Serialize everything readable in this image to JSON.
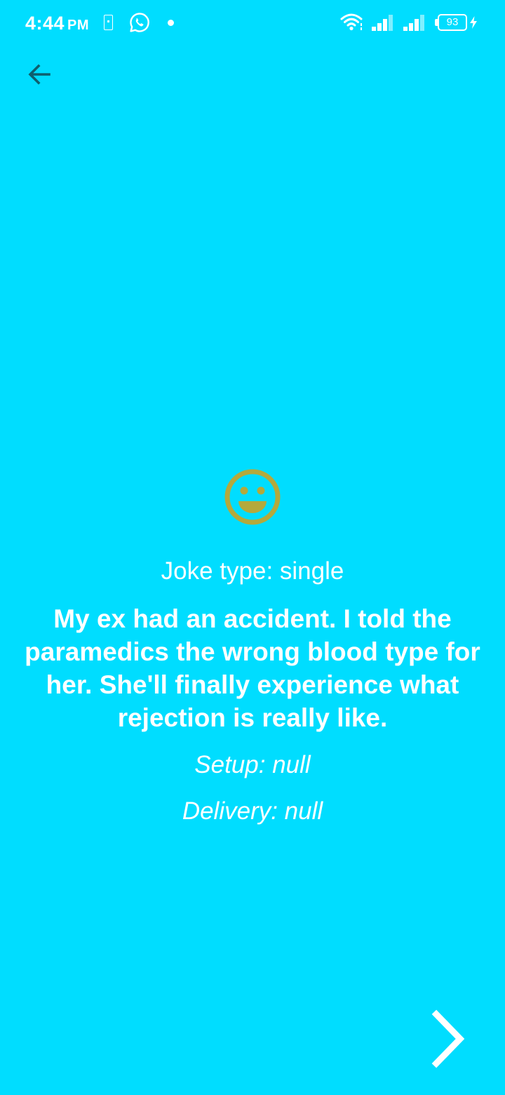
{
  "status_bar": {
    "time": "4:44",
    "ampm": "PM",
    "battery_level": "93"
  },
  "icons": {
    "back": "arrow-left-icon",
    "emoji": "grinning-face-icon",
    "next": "chevron-right-icon",
    "whatsapp": "whatsapp-icon",
    "wifi": "wifi-icon",
    "signal": "signal-icon",
    "battery": "battery-icon",
    "charging": "bolt-icon",
    "sim": "sim-icon"
  },
  "colors": {
    "background": "#00DDFF",
    "emoji": "#B4A93C",
    "back_arrow": "#0F5F6E",
    "text": "#FFFFFF"
  },
  "joke": {
    "type_label": "Joke type: single",
    "text": "My ex had an accident. I told the paramedics the wrong blood type for her. She'll finally experience what rejection is really like.",
    "setup_label": "Setup: null",
    "delivery_label": "Delivery: null"
  }
}
